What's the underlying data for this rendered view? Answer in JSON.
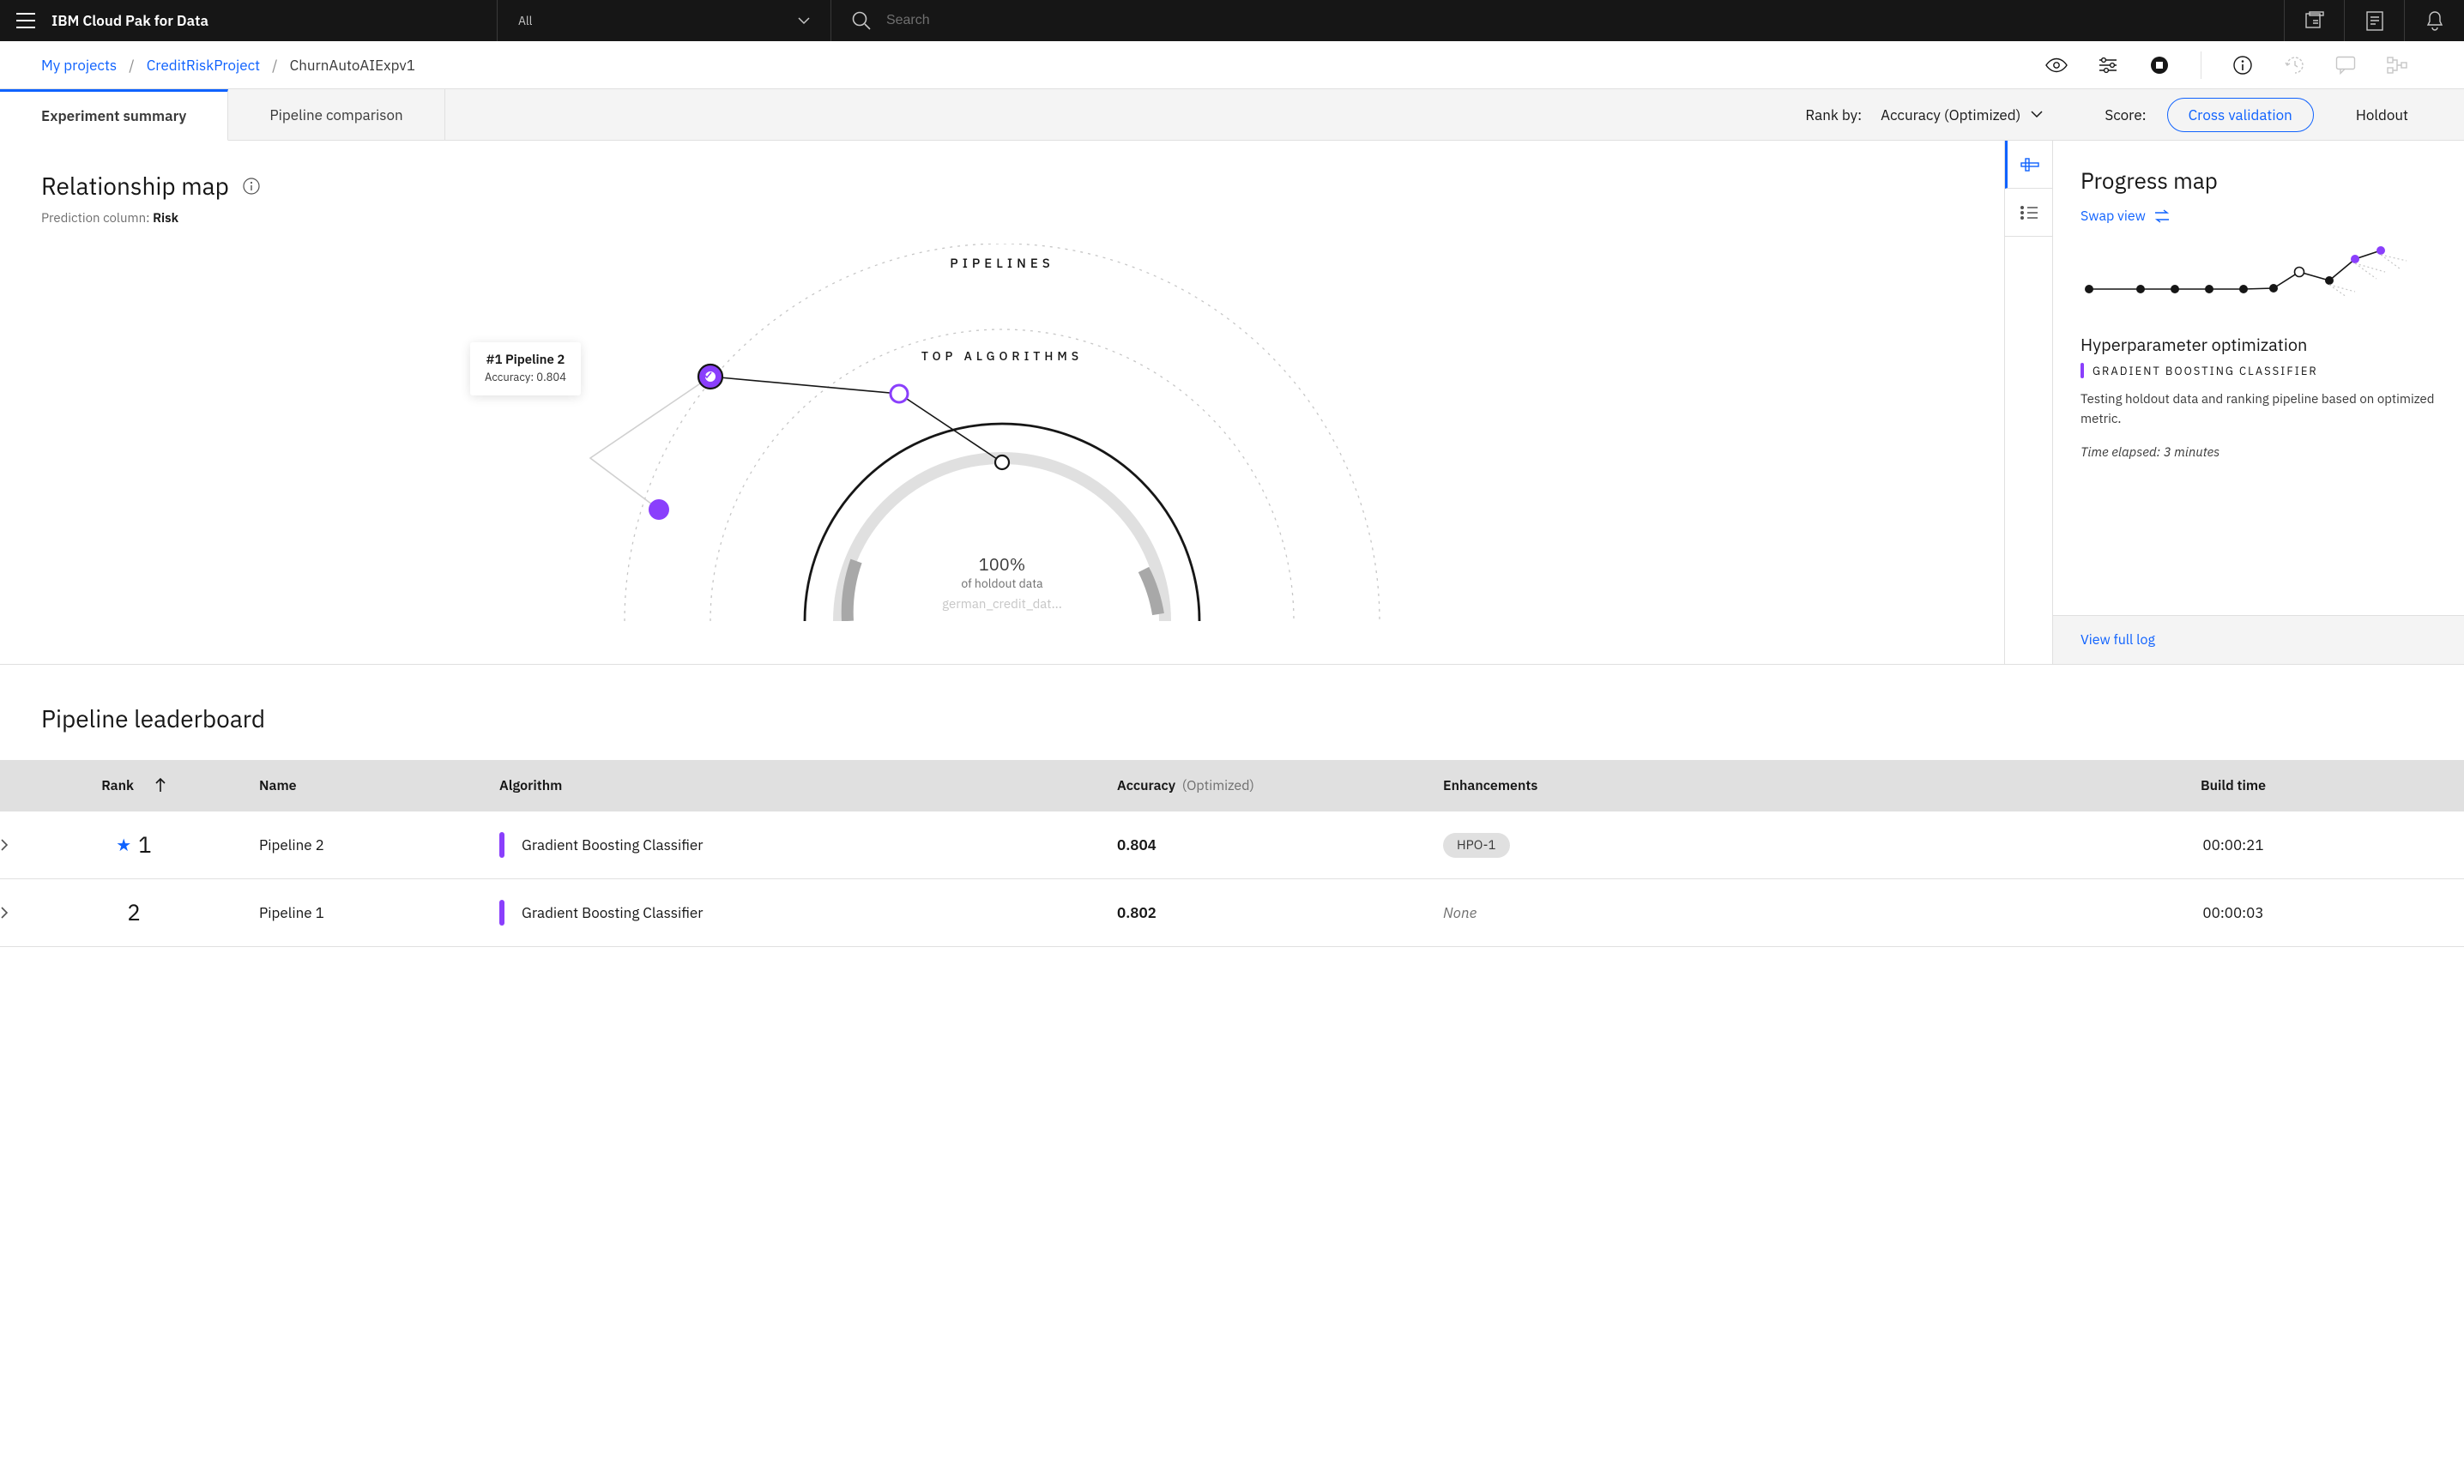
{
  "topbar": {
    "brand": "IBM Cloud Pak for Data",
    "scope": "All",
    "search_placeholder": "Search"
  },
  "breadcrumbs": {
    "items": [
      {
        "label": "My projects",
        "link": true
      },
      {
        "label": "CreditRiskProject",
        "link": true
      },
      {
        "label": "ChurnAutoAIExpv1",
        "link": false
      }
    ]
  },
  "tabs": {
    "items": [
      {
        "label": "Experiment summary",
        "active": true
      },
      {
        "label": "Pipeline comparison",
        "active": false
      }
    ],
    "rank_by_label": "Rank by:",
    "rank_by_value": "Accuracy (Optimized)",
    "score_label": "Score:",
    "score_options": [
      {
        "label": "Cross validation",
        "active": true
      },
      {
        "label": "Holdout",
        "active": false
      }
    ]
  },
  "relmap": {
    "title": "Relationship map",
    "pred_label": "Prediction column:",
    "pred_value": "Risk",
    "arc_outer": "PIPELINES",
    "arc_inner": "TOP ALGORITHMS",
    "center_pct": "100%",
    "center_sub": "of holdout data",
    "center_file": "german_credit_dat...",
    "tip_title": "#1 Pipeline 2",
    "tip_sub": "Accuracy: 0.804"
  },
  "progress": {
    "title": "Progress map",
    "swap": "Swap view",
    "hpo_title": "Hyperparameter optimization",
    "hpo_sub": "GRADIENT BOOSTING CLASSIFIER",
    "hpo_desc": "Testing holdout data and ranking pipeline based on optimized metric.",
    "elapsed": "Time elapsed: 3 minutes",
    "view_log": "View full log"
  },
  "leaderboard": {
    "title": "Pipeline leaderboard",
    "cols": {
      "rank": "Rank",
      "name": "Name",
      "algorithm": "Algorithm",
      "accuracy": "Accuracy",
      "accuracy_suffix": "(Optimized)",
      "enh": "Enhancements",
      "build": "Build time"
    },
    "rows": [
      {
        "starred": true,
        "rank": "1",
        "name": "Pipeline 2",
        "algo": "Gradient Boosting Classifier",
        "acc": "0.804",
        "enh": "HPO-1",
        "enh_chip": true,
        "build": "00:00:21"
      },
      {
        "starred": false,
        "rank": "2",
        "name": "Pipeline 1",
        "algo": "Gradient Boosting Classifier",
        "acc": "0.802",
        "enh": "None",
        "enh_chip": false,
        "build": "00:00:03"
      }
    ]
  }
}
